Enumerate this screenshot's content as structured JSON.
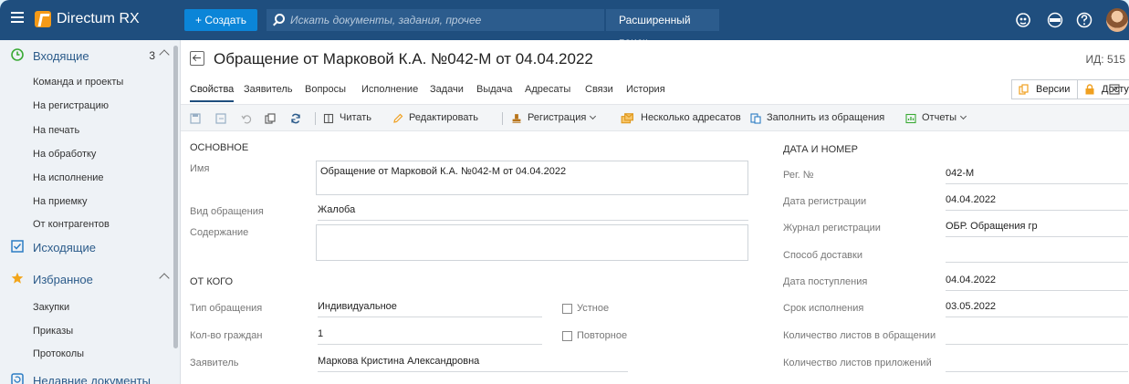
{
  "app": {
    "name": "Directum RX"
  },
  "topbar": {
    "create_label": "+ Создать",
    "search_placeholder": "Искать документы, задания, прочее",
    "advanced_search_label": "Расширенный поиск"
  },
  "sidebar": {
    "incoming": {
      "label": "Входящие",
      "count": "3"
    },
    "incoming_items": [
      "Команда и проекты",
      "На регистрацию",
      "На печать",
      "На обработку",
      "На исполнение",
      "На приемку",
      "От контрагентов"
    ],
    "outgoing": {
      "label": "Исходящие"
    },
    "favorites": {
      "label": "Избранное"
    },
    "favorites_items": [
      "Закупки",
      "Приказы",
      "Протоколы"
    ],
    "recent": {
      "label": "Недавние документы"
    }
  },
  "document": {
    "title": "Обращение от Марковой К.А. №042-М от 04.04.2022",
    "id_label": "ИД: 515"
  },
  "tabs": [
    "Свойства",
    "Заявитель",
    "Вопросы",
    "Исполнение",
    "Задачи",
    "Выдача",
    "Адресаты",
    "Связи",
    "История"
  ],
  "tab_buttons": {
    "versions": "Версии",
    "access": "Доступ"
  },
  "toolbar": {
    "read": "Читать",
    "edit": "Редактировать",
    "registration": "Регистрация",
    "multiple_addressees": "Несколько адресатов",
    "fill_from_request": "Заполнить из обращения",
    "reports": "Отчеты"
  },
  "form": {
    "main_section": "ОСНОВНОЕ",
    "name_label": "Имя",
    "name_value": "Обращение от Марковой К.А. №042-М от 04.04.2022",
    "type_label": "Вид обращения",
    "type_value": "Жалоба",
    "content_label": "Содержание",
    "content_value": "",
    "from_section": "ОТ КОГО",
    "request_type_label": "Тип обращения",
    "request_type_value": "Индивидуальное",
    "oral_label": "Устное",
    "citizens_label": "Кол-во граждан",
    "citizens_value": "1",
    "repeat_label": "Повторное",
    "applicant_label": "Заявитель",
    "applicant_value": "Маркова Кристина Александровна",
    "date_section": "ДАТА И НОМЕР",
    "reg_no_label": "Рег. №",
    "reg_no_value": "042-М",
    "reg_date_label": "Дата регистрации",
    "reg_date_value": "04.04.2022",
    "journal_label": "Журнал регистрации",
    "journal_value": "ОБР. Обращения гр",
    "delivery_label": "Способ доставки",
    "delivery_value": "",
    "received_label": "Дата поступления",
    "received_value": "04.04.2022",
    "deadline_label": "Срок исполнения",
    "deadline_value": "03.05.2022",
    "sheets_label": "Количество листов в обращении",
    "sheets_value": "",
    "attach_sheets_label": "Количество листов приложений",
    "attach_sheets_value": ""
  },
  "colors": {
    "topbar": "#1f4e7e",
    "accent": "#0b85d8",
    "brand": "#f59a17"
  }
}
